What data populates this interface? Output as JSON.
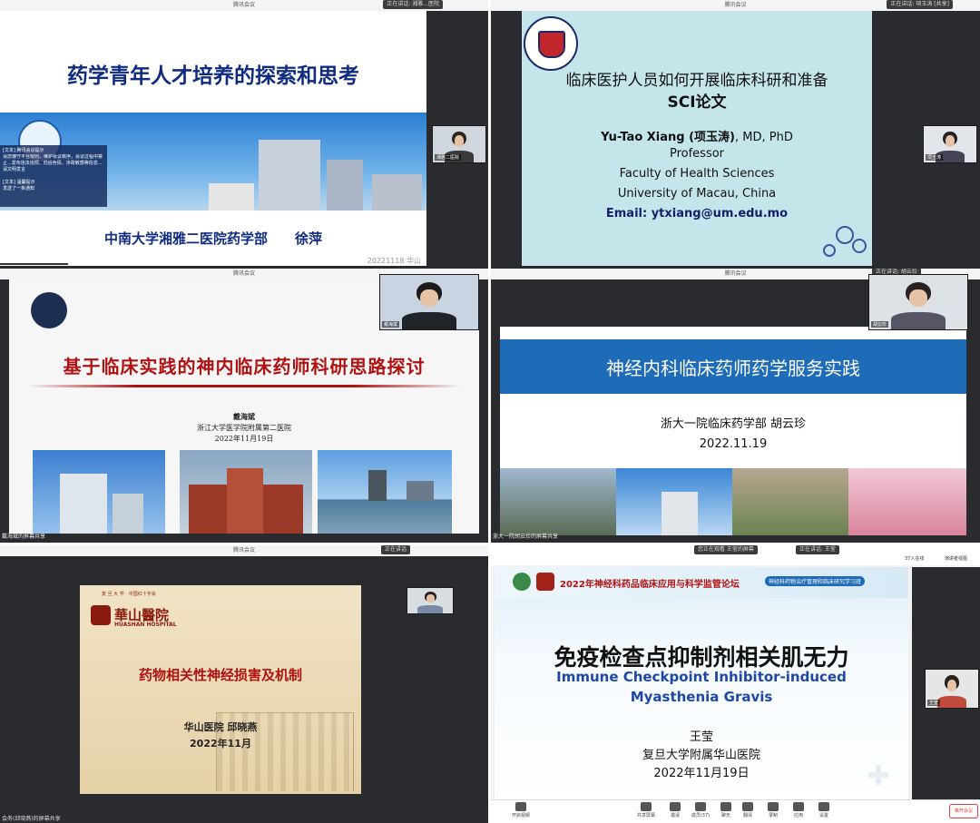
{
  "window_title": "腾讯会议",
  "p1": {
    "speaker_indicator": "正在讲话: 湘雅...医院",
    "title": "药学青年人才培养的探索和思考",
    "chat": [
      "[文本] 腾讯会议提示",
      "请您遵守平台规则，维护会议秩序，会议过程中禁止...发布违法违规、低俗色情、涉政敏感等信息...请文明发言",
      "[文本] 温馨提示",
      "发送了一条通知"
    ],
    "footer": "中南大学湘雅二医院药学部　　徐萍",
    "date": "20221118 华山",
    "cam_tag": "湘雅二医院"
  },
  "p2": {
    "speaker_indicator": "正在讲话: 项玉涛 [共享]",
    "title_line1": "临床医护人员如何开展临床科研和准备",
    "title_line2": "SCI论文",
    "name_bold": "Yu-Tao Xiang (项玉涛)",
    "name_rest": ", MD, PhD",
    "lines": [
      "Professor",
      "Faculty of Health Sciences",
      "University of Macau, China"
    ],
    "email": "Email: ytxiang@um.edu.mo",
    "cam_tag": "项玉涛"
  },
  "p3": {
    "speaker_indicator": "正在讲话: 戴海斌",
    "title": "基于临床实践的神内临床药师科研思路探讨",
    "author": "戴海斌",
    "org": "浙江大学医学院附属第二医院",
    "date": "2022年11月19日",
    "share_label": "戴海斌的屏幕共享",
    "cam_tag": "戴海斌"
  },
  "p4": {
    "speaker_indicator": "正在讲话: 胡云珍",
    "title": "神经内科临床药师药学服务实践",
    "org": "浙大一院临床药学部 胡云珍",
    "date": "2022.11.19",
    "share_label": "浙大一院胡云珍的屏幕共享",
    "cam_tag": "胡云珍"
  },
  "p5": {
    "speaker_indicator": "正在讲话",
    "header": "复 旦 大 学　中国红十字会",
    "logo_cn": "華山醫院",
    "logo_en": "HUASHAN HOSPITAL",
    "title": "药物相关性神经损害及机制",
    "author": "华山医院 邱晓燕",
    "date": "2022年11月",
    "share_label": "会务(邱晓燕)的屏幕共享"
  },
  "p6": {
    "top_left": "您正在观看 王莹的屏幕",
    "speaking": "正在讲话: 王莹",
    "participants": "37人在线",
    "view": "演讲者视图",
    "banner": "2022年神经科药品临床应用与科学监管论坛",
    "banner_tag": "神经科药物治疗管理和临床研究学习班",
    "title_cn": "免疫检查点抑制剂相关肌无力",
    "title_en1": "Immune Checkpoint Inhibitor-induced",
    "title_en2": "Myasthenia Gravis",
    "author": "王莹",
    "org": "复旦大学附属华山医院",
    "date": "2022年11月19日",
    "cam_tag": "王莹",
    "end_button": "离开会议",
    "toolbar": [
      "开启视频",
      "共享屏幕",
      "邀请",
      "成员(37)",
      "聊天",
      "翻译",
      "录制",
      "应用",
      "设置"
    ]
  },
  "colors": {
    "blue_banner": "#1e6bb8",
    "red_title": "#b01212",
    "navy_text": "#14206b"
  }
}
